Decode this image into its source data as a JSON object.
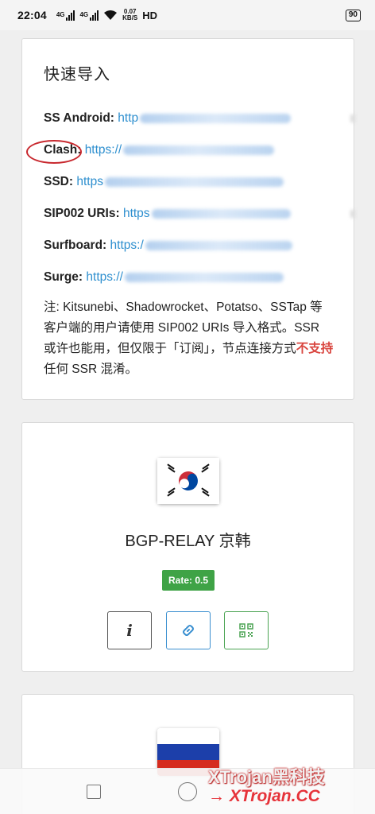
{
  "status_bar": {
    "time": "22:04",
    "net1": "4G",
    "net2": "4G",
    "speed_value": "0.07",
    "speed_unit": "KB/S",
    "hd": "HD",
    "battery": "90"
  },
  "quick_import": {
    "title": "快速导入",
    "rows": [
      {
        "label": "SS Android:",
        "url_prefix": "http"
      },
      {
        "label": "Clash:",
        "url_prefix": "https://"
      },
      {
        "label": "SSD:",
        "url_prefix": "https"
      },
      {
        "label": "SIP002 URIs:",
        "url_prefix": "https"
      },
      {
        "label": "Surfboard:",
        "url_prefix": "https:/"
      },
      {
        "label": "Surge:",
        "url_prefix": "https://"
      }
    ],
    "note_part1": "注: Kitsunebi、Shadowrocket、Potatso、SSTap 等客户端的用户请使用 SIP002 URIs 导入格式。SSR 或许也能用，但仅限于「订阅」，节点连接方式",
    "note_red": "不支持",
    "note_part2": "任何 SSR 混淆。"
  },
  "node": {
    "flag_icon": "south-korea-flag-icon",
    "name": "BGP-RELAY 京韩",
    "rate": "Rate: 0.5",
    "info_label": "i",
    "accent_colors": {
      "rate": "#3fa346",
      "link": "#3a8fd0",
      "qr": "#4aa352"
    }
  },
  "next_node": {
    "flag_icon": "russia-flag-icon"
  },
  "watermark": {
    "line1": "XTrojan黑科技",
    "line2": "→ XTrojan.CC"
  }
}
